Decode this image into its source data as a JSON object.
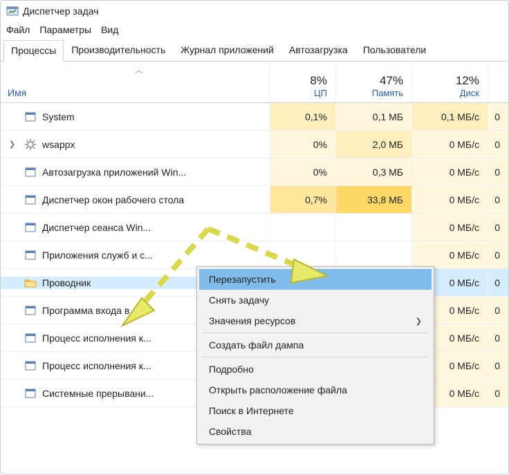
{
  "window": {
    "title": "Диспетчер задач"
  },
  "menubar": {
    "file": "Файл",
    "options": "Параметры",
    "view": "Вид"
  },
  "tabs": {
    "processes": "Процессы",
    "performance": "Производительность",
    "apphistory": "Журнал приложений",
    "startup": "Автозагрузка",
    "users": "Пользователи"
  },
  "columns": {
    "name": "Имя",
    "cpu": {
      "pct": "8%",
      "label": "ЦП"
    },
    "mem": {
      "pct": "47%",
      "label": "Память"
    },
    "disk": {
      "pct": "12%",
      "label": "Диск"
    }
  },
  "rows": [
    {
      "name": "System",
      "cpu": "0,1%",
      "mem": "0,1 МБ",
      "disk": "0,1 МБ/с",
      "net": "0",
      "expandable": false,
      "icon": "window"
    },
    {
      "name": "wsappx",
      "cpu": "0%",
      "mem": "2,0 МБ",
      "disk": "0 МБ/с",
      "net": "0",
      "expandable": true,
      "icon": "gear"
    },
    {
      "name": "Автозагрузка приложений Win...",
      "cpu": "0%",
      "mem": "0,3 МБ",
      "disk": "0 МБ/с",
      "net": "0",
      "expandable": false,
      "icon": "window"
    },
    {
      "name": "Диспетчер окон рабочего стола",
      "cpu": "0,7%",
      "mem": "33,8 МБ",
      "disk": "0 МБ/с",
      "net": "0",
      "expandable": false,
      "icon": "window"
    },
    {
      "name": "Диспетчер сеанса Win...",
      "cpu": "",
      "mem": "",
      "disk": "0 МБ/с",
      "net": "0",
      "expandable": false,
      "icon": "window"
    },
    {
      "name": "Приложения служб и с...",
      "cpu": "",
      "mem": "",
      "disk": "0 МБ/с",
      "net": "0",
      "expandable": false,
      "icon": "window"
    },
    {
      "name": "Проводник",
      "cpu": "",
      "mem": "",
      "disk": "0 МБ/с",
      "net": "0",
      "expandable": false,
      "icon": "folder",
      "selected": true
    },
    {
      "name": "Программа входа в с...",
      "cpu": "",
      "mem": "",
      "disk": "0 МБ/с",
      "net": "0",
      "expandable": false,
      "icon": "window"
    },
    {
      "name": "Процесс исполнения к...",
      "cpu": "",
      "mem": "",
      "disk": "0 МБ/с",
      "net": "0",
      "expandable": false,
      "icon": "window"
    },
    {
      "name": "Процесс исполнения к...",
      "cpu": "",
      "mem": "",
      "disk": "0 МБ/с",
      "net": "0",
      "expandable": false,
      "icon": "window"
    },
    {
      "name": "Системные прерывани...",
      "cpu": "",
      "mem": "",
      "disk": "0 МБ/с",
      "net": "0",
      "expandable": false,
      "icon": "window"
    }
  ],
  "contextmenu": {
    "restart": "Перезапустить",
    "endtask": "Снять задачу",
    "resource": "Значения ресурсов",
    "dump": "Создать файл дампа",
    "details": "Подробно",
    "openloc": "Открыть расположение файла",
    "search": "Поиск в Интернете",
    "props": "Свойства"
  },
  "icons": {
    "window_svg": "",
    "gear_svg": "",
    "folder_svg": ""
  }
}
